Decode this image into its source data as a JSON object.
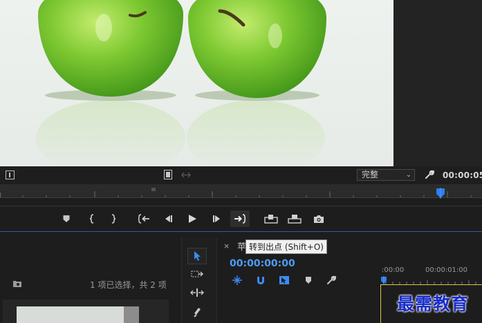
{
  "monitor": {
    "fit_value": "完整",
    "timecode": "00:00:05"
  },
  "transport": {
    "tooltip": "转到出点 (Shift+O)"
  },
  "project": {
    "status": "1 项已选择，共 2 项"
  },
  "timeline": {
    "tab_label": "苹",
    "tab_close": "×",
    "timecode": "00:00:00:00",
    "ruler_times": [
      ":00:00",
      "00:00:01:00"
    ]
  },
  "watermark": "最需教育",
  "colors": {
    "accent_blue": "#4d9cf6",
    "playhead_blue": "#2d7ff0",
    "in_out_yellow": "#d8c84a"
  }
}
